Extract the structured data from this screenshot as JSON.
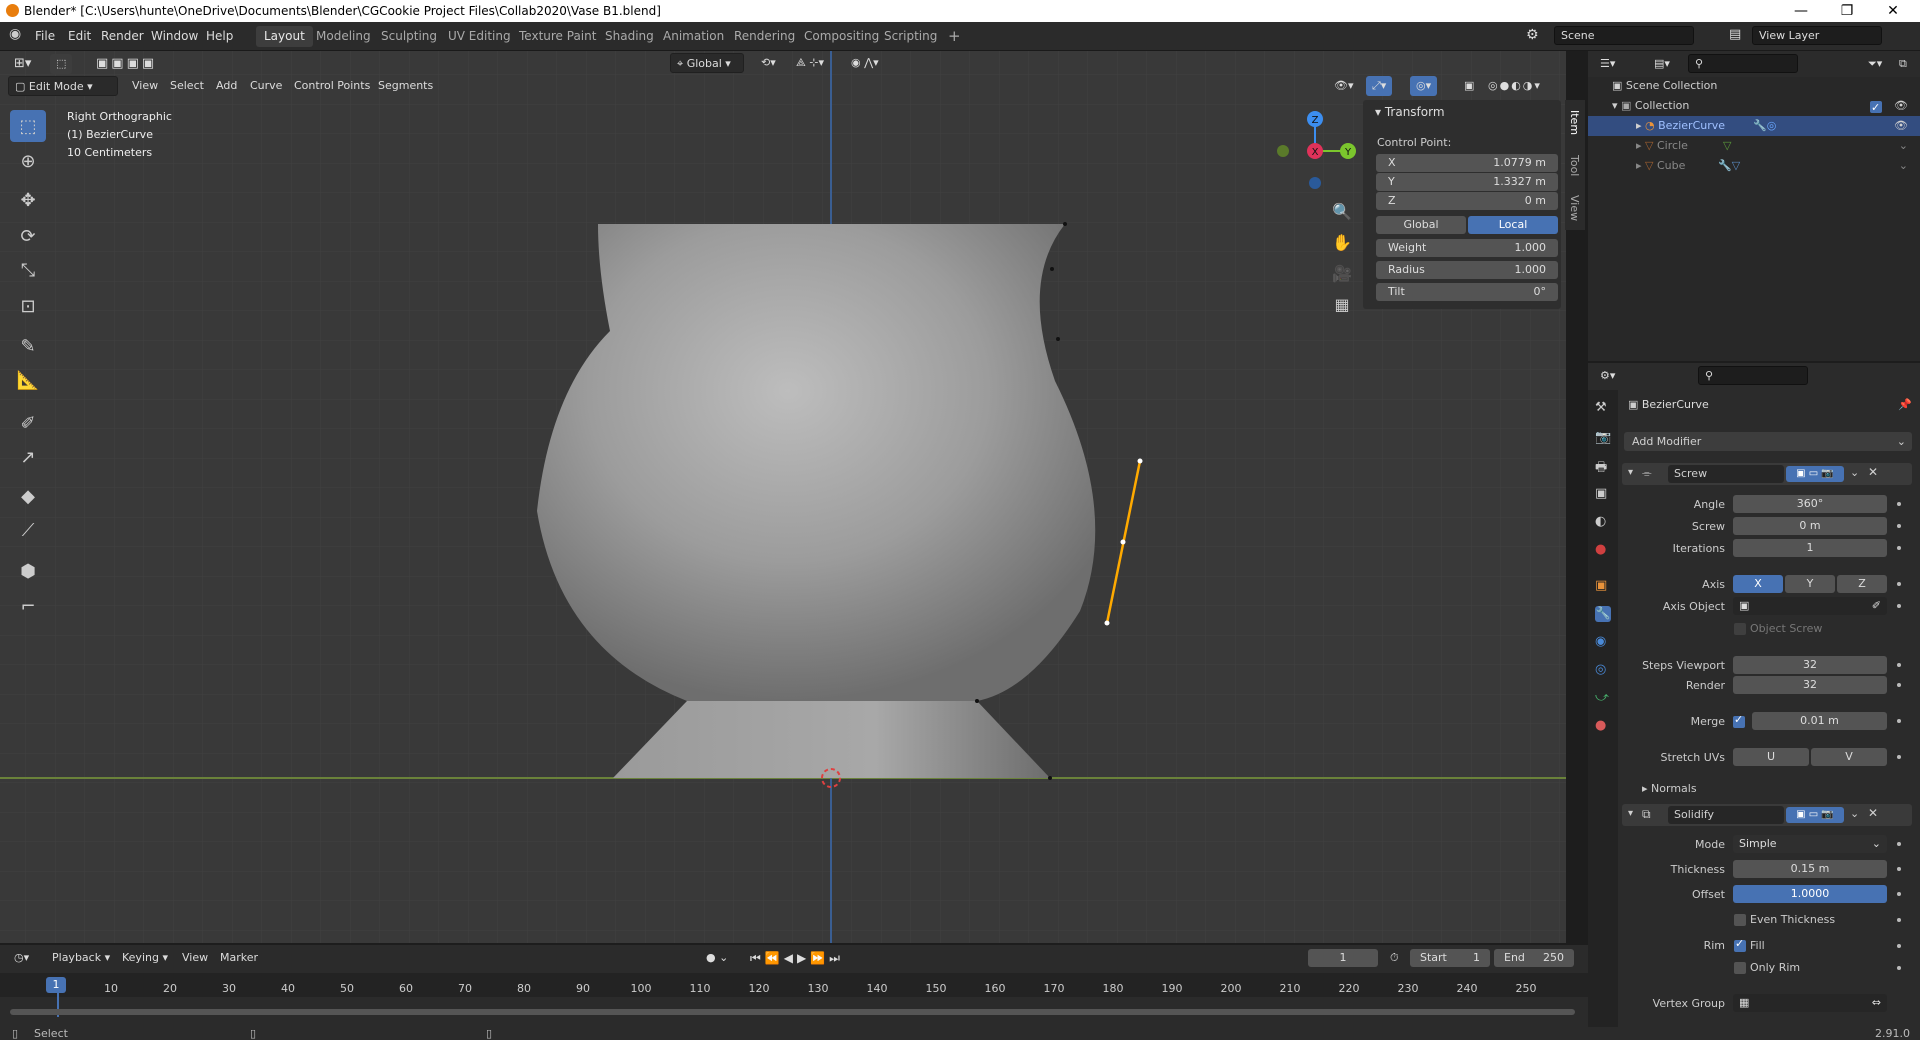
{
  "window": {
    "title": "Blender* [C:\\Users\\hunte\\OneDrive\\Documents\\Blender\\CGCookie Project Files\\Collab2020\\Vase B1.blend]",
    "controls": [
      "—",
      "❐",
      "✕"
    ]
  },
  "menu": [
    "File",
    "Edit",
    "Render",
    "Window",
    "Help"
  ],
  "workspaces": [
    "Layout",
    "Modeling",
    "Sculpting",
    "UV Editing",
    "Texture Paint",
    "Shading",
    "Animation",
    "Rendering",
    "Compositing",
    "Scripting"
  ],
  "active_workspace": "Layout",
  "add_workspace": "+",
  "scene": {
    "name": "Scene",
    "view_layer": "View Layer"
  },
  "viewport": {
    "transform_orientation": "Global",
    "mode": "Edit Mode",
    "menus": [
      "View",
      "Select",
      "Add",
      "Curve",
      "Control Points",
      "Segments"
    ],
    "overlay_text": [
      "Right Orthographic",
      "(1) BezierCurve",
      "10 Centimeters"
    ],
    "gizmo_axes": {
      "x": "X",
      "y": "Y",
      "z": "Z"
    },
    "side_tabs": [
      "Item",
      "Tool",
      "View"
    ]
  },
  "transform_panel": {
    "title": "Transform",
    "subtitle": "Control Point:",
    "rows": [
      {
        "label": "X",
        "value": "1.0779 m"
      },
      {
        "label": "Y",
        "value": "1.3327 m"
      },
      {
        "label": "Z",
        "value": "0 m"
      }
    ],
    "space_options": [
      "Global",
      "Local"
    ],
    "active_space": "Local",
    "extras": [
      {
        "label": "Weight",
        "value": "1.000"
      },
      {
        "label": "Radius",
        "value": "1.000"
      },
      {
        "label": "Tilt",
        "value": "0°"
      }
    ]
  },
  "outliner": {
    "scene_collection": "Scene Collection",
    "collection": "Collection",
    "objects": [
      {
        "name": "BezierCurve",
        "selected": true
      },
      {
        "name": "Circle",
        "selected": false
      },
      {
        "name": "Cube",
        "selected": false
      }
    ]
  },
  "properties": {
    "object_name": "BezierCurve",
    "add_modifier": "Add Modifier",
    "screw": {
      "name": "Screw",
      "angle_label": "Angle",
      "angle": "360°",
      "screw_label": "Screw",
      "screw": "0 m",
      "iterations_label": "Iterations",
      "iterations": "1",
      "axis_label": "Axis",
      "axes": [
        "X",
        "Y",
        "Z"
      ],
      "active_axis": "X",
      "axis_object_label": "Axis Object",
      "object_screw": "Object Screw",
      "steps_viewport_label": "Steps Viewport",
      "steps_viewport": "32",
      "render_label": "Render",
      "render": "32",
      "merge_label": "Merge",
      "merge": "0.01 m",
      "stretch_uvs_label": "Stretch UVs",
      "stretch_u": "U",
      "stretch_v": "V",
      "normals": "Normals"
    },
    "solidify": {
      "name": "Solidify",
      "mode_label": "Mode",
      "mode": "Simple",
      "thickness_label": "Thickness",
      "thickness": "0.15 m",
      "offset_label": "Offset",
      "offset": "1.0000",
      "even_thickness": "Even Thickness",
      "rim_label": "Rim",
      "fill": "Fill",
      "only_rim": "Only Rim",
      "vertex_group_label": "Vertex Group"
    }
  },
  "timeline": {
    "menus": [
      "Playback",
      "Keying",
      "View",
      "Marker"
    ],
    "current_frame": "1",
    "start_label": "Start",
    "start": "1",
    "end_label": "End",
    "end": "250",
    "ticks": [
      "1",
      "10",
      "20",
      "30",
      "40",
      "50",
      "60",
      "70",
      "80",
      "90",
      "100",
      "110",
      "120",
      "130",
      "140",
      "150",
      "160",
      "170",
      "180",
      "190",
      "200",
      "210",
      "220",
      "230",
      "240",
      "250"
    ]
  },
  "status": {
    "left": "Select",
    "version": "2.91.0"
  },
  "colors": {
    "accent": "#4772b3",
    "curve_selected": "#ffaa00",
    "x_axis": "#e0325a",
    "y_axis": "#7bc62d",
    "z_axis": "#3c8ef0"
  }
}
